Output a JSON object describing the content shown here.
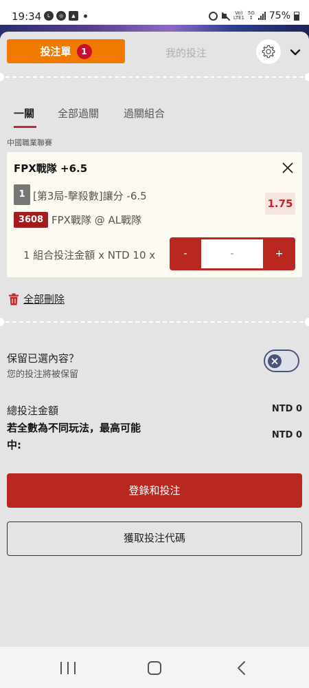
{
  "status_bar": {
    "time": "19:34",
    "battery": "75%",
    "left_icons": [
      "line-icon",
      "chrome-icon",
      "gallery-icon",
      "dot-icon"
    ],
    "right_icons": [
      "alarm-icon",
      "mute-icon",
      "volte-icon",
      "5g-icon",
      "signal-icon",
      "battery-icon"
    ]
  },
  "header": {
    "betslip_label": "投注單",
    "betslip_count": "1",
    "mybets_label": "我的投注"
  },
  "bet_tabs": [
    {
      "label": "一關",
      "active": true
    },
    {
      "label": "全部過關",
      "active": false
    },
    {
      "label": "過關組合",
      "active": false
    }
  ],
  "league": "中國職業聯賽",
  "selection": {
    "title": "FPX戰隊 +6.5",
    "number": "1",
    "market": "[第3局-擊殺數]讓分 -6.5",
    "odds": "1.75",
    "event_id": "3608",
    "event_name": "FPX戰隊 @ AL戰隊",
    "stake_label": "1 組合投注金額 x NTD 10 x",
    "stepper_minus": "-",
    "stepper_value": "-",
    "stepper_plus": "+"
  },
  "delete_all_label": "全部刪除",
  "keep_selection": {
    "title": "保留已選內容？",
    "subtitle": "您的投注將被保留",
    "enabled": false
  },
  "totals": {
    "total_label": "總投注金額",
    "total_value": "NTD 0",
    "max_win_label": "若全數為不同玩法，最高可能中:",
    "max_win_value": "NTD 0"
  },
  "buttons": {
    "login_bet": "登錄和投注",
    "get_code": "獲取投注代碼"
  },
  "colors": {
    "primary_red": "#b82820",
    "orange": "#f07a00",
    "badge_red": "#c8102e",
    "odds_text": "#c1272d",
    "card_bg": "#fdfaf1"
  }
}
